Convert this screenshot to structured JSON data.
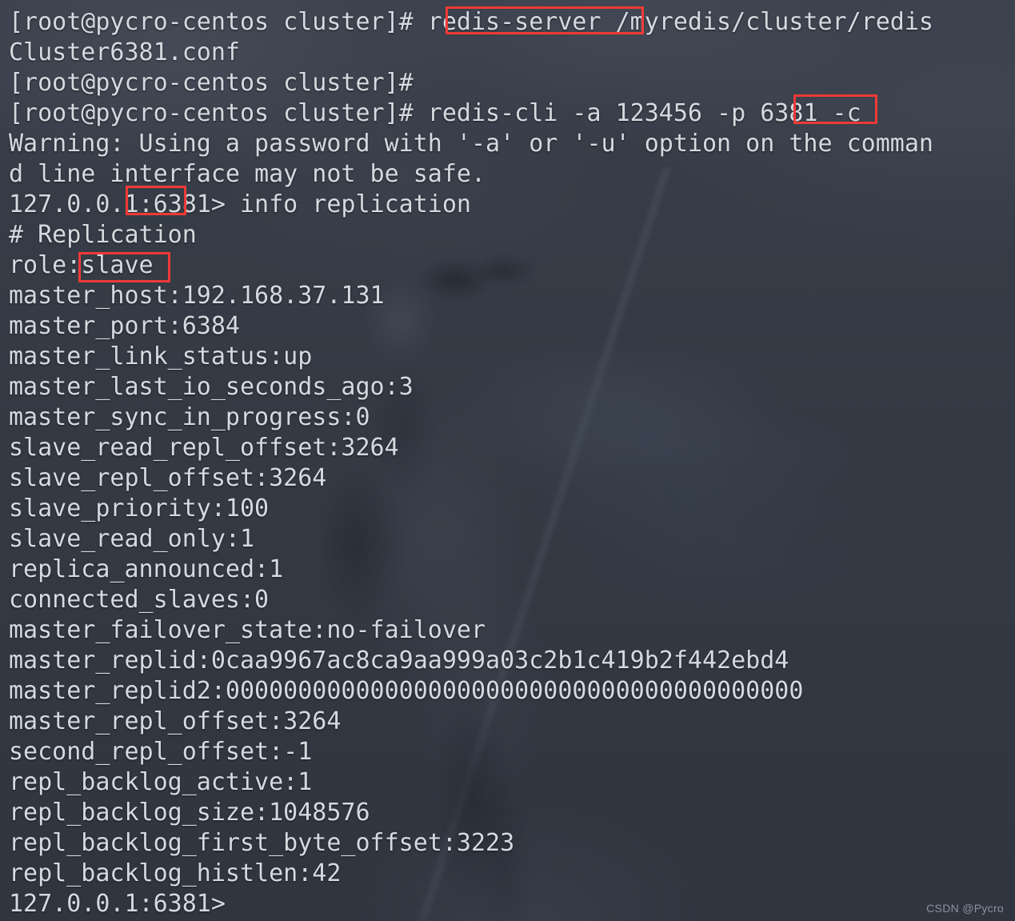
{
  "terminal": {
    "background_color": "#383e49",
    "text_color": "#d6d9df",
    "highlight_color": "#f03a36",
    "lines": [
      "[root@pycro-centos cluster]# redis-server /myredis/cluster/redis",
      "Cluster6381.conf",
      "[root@pycro-centos cluster]#",
      "[root@pycro-centos cluster]# redis-cli -a 123456 -p 6381 -c",
      "Warning: Using a password with '-a' or '-u' option on the comman",
      "d line interface may not be safe.",
      "127.0.0.1:6381> info replication",
      "# Replication",
      "role:slave",
      "master_host:192.168.37.131",
      "master_port:6384",
      "master_link_status:up",
      "master_last_io_seconds_ago:3",
      "master_sync_in_progress:0",
      "slave_read_repl_offset:3264",
      "slave_repl_offset:3264",
      "slave_priority:100",
      "slave_read_only:1",
      "replica_announced:1",
      "connected_slaves:0",
      "master_failover_state:no-failover",
      "master_replid:0caa9967ac8ca9aa999a03c2b1c419b2f442ebd4",
      "master_replid2:0000000000000000000000000000000000000000",
      "master_repl_offset:3264",
      "second_repl_offset:-1",
      "repl_backlog_active:1",
      "repl_backlog_size:1048576",
      "repl_backlog_first_byte_offset:3223",
      "repl_backlog_histlen:42",
      "127.0.0.1:6381>"
    ],
    "highlights": [
      {
        "id": "hl-redis-server",
        "label": "redis-server"
      },
      {
        "id": "hl-port-flag",
        "label": "6381"
      },
      {
        "id": "hl-prompt-port",
        "label": ":6381"
      },
      {
        "id": "hl-role-slave",
        "label": ":slave"
      }
    ]
  },
  "watermark": {
    "text": "CSDN @Pycro"
  }
}
